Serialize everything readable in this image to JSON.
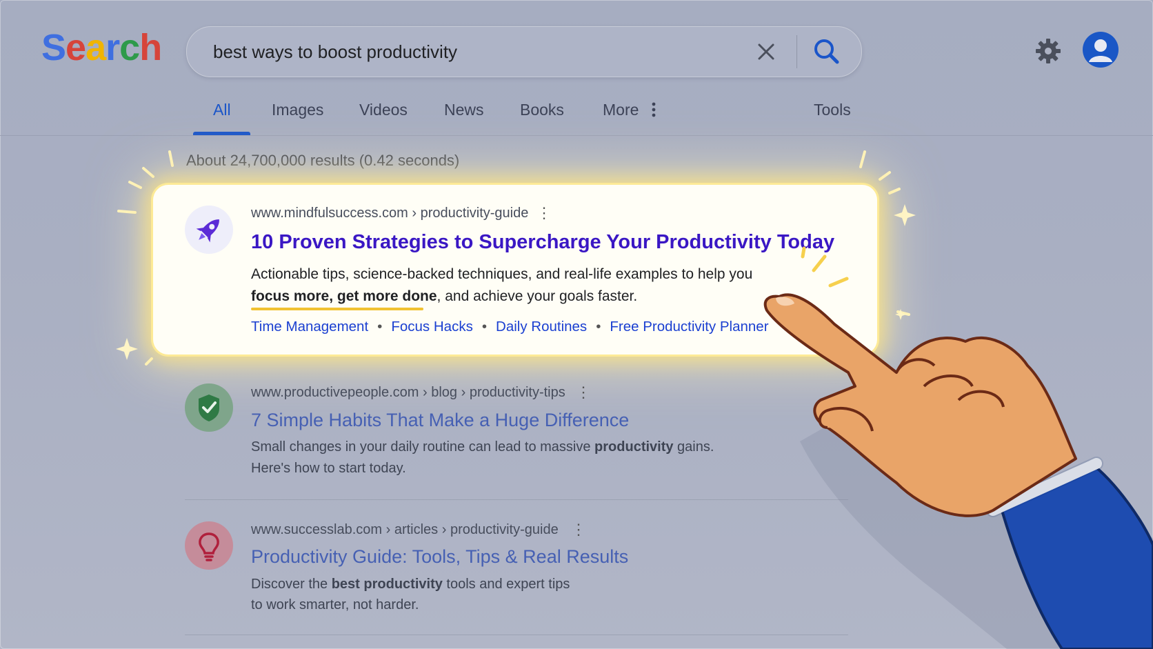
{
  "logo": {
    "letters": [
      {
        "ch": "S",
        "color": "#3f6fe0"
      },
      {
        "ch": "e",
        "color": "#d6443a"
      },
      {
        "ch": "a",
        "color": "#f0b400"
      },
      {
        "ch": "r",
        "color": "#3f6fe0"
      },
      {
        "ch": "c",
        "color": "#2e9a4a"
      },
      {
        "ch": "h",
        "color": "#d6443a"
      }
    ]
  },
  "search": {
    "query": "best ways to boost productivity"
  },
  "tabs": {
    "all": "All",
    "images": "Images",
    "videos": "Videos",
    "news": "News",
    "books": "Books",
    "more": "More",
    "tools": "Tools"
  },
  "stats": "About 24,700,000 results (0.42 seconds)",
  "results": [
    {
      "url": "www.mindfulsuccess.com › productivity-guide",
      "title": "10 Proven Strategies to Supercharge Your Productivity Today",
      "snippet_line1": "Actionable tips, science-backed techniques, and real-life examples to help you",
      "snippet_bold": "focus more, get more done",
      "snippet_rest": ", and achieve your goals faster.",
      "sitelinks": [
        "Time Management",
        "Focus Hacks",
        "Daily Routines",
        "Free Productivity Planner"
      ],
      "icon": "rocket-icon"
    },
    {
      "url": "www.productivepeople.com › blog › productivity-tips",
      "title": "7 Simple Habits That Make a Huge Difference",
      "snippet_a": "Small changes in your daily routine can lead to massive ",
      "snippet_bold": "productivity",
      "snippet_b": " gains.",
      "snippet_line2": "Here's how to start today.",
      "icon": "shield-check-icon"
    },
    {
      "url": "www.successlab.com › articles › productivity-guide",
      "title": "Productivity Guide: Tools, Tips & Real Results",
      "snippet_a": "Discover the ",
      "snippet_bold": "best productivity",
      "snippet_b": " tools and expert tips",
      "snippet_line2": "to work smarter, not harder.",
      "icon": "lightbulb-icon"
    }
  ],
  "colors": {
    "link_blue": "#1a3fd1",
    "title_purple": "#3a17c4",
    "accent_blue": "#1a55c9",
    "glow": "#f6d04d"
  }
}
